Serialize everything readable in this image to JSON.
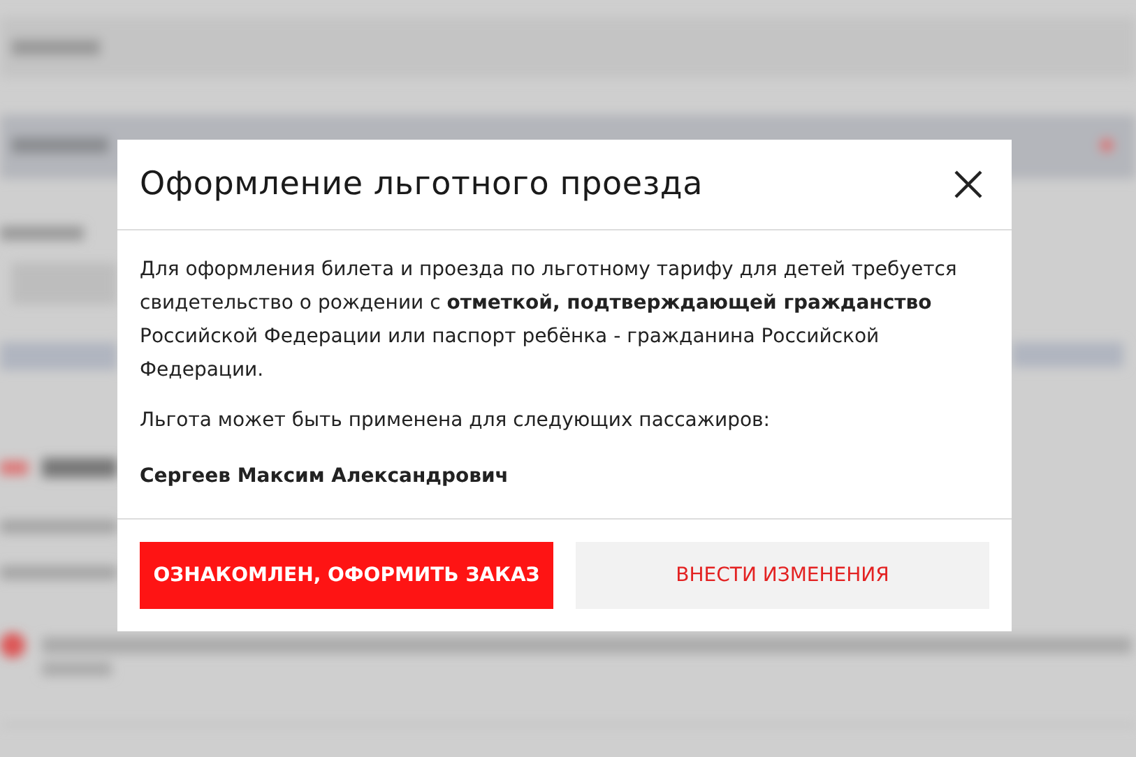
{
  "dialog": {
    "title": "Оформление льготного проезда",
    "paragraphs": [
      "Для оформления билета и проезда по льготному тарифу для детей требуется свидетельство о рождении с **отметкой, подтверждающей гражданство** Российской Федерации или паспорт ребёнка - гражданина Российской Федерации.",
      "Льгота может быть применена для следующих пассажиров:"
    ],
    "passengers": [
      "Сергеев Максим Александрович"
    ],
    "buttons": [
      {
        "label": "ОЗНАКОМЛЕН, ОФОРМИТЬ ЗАКАЗ",
        "kind": "primary"
      },
      {
        "label": "ВНЕСТИ ИЗМЕНЕНИЯ",
        "kind": "secondary"
      }
    ]
  }
}
